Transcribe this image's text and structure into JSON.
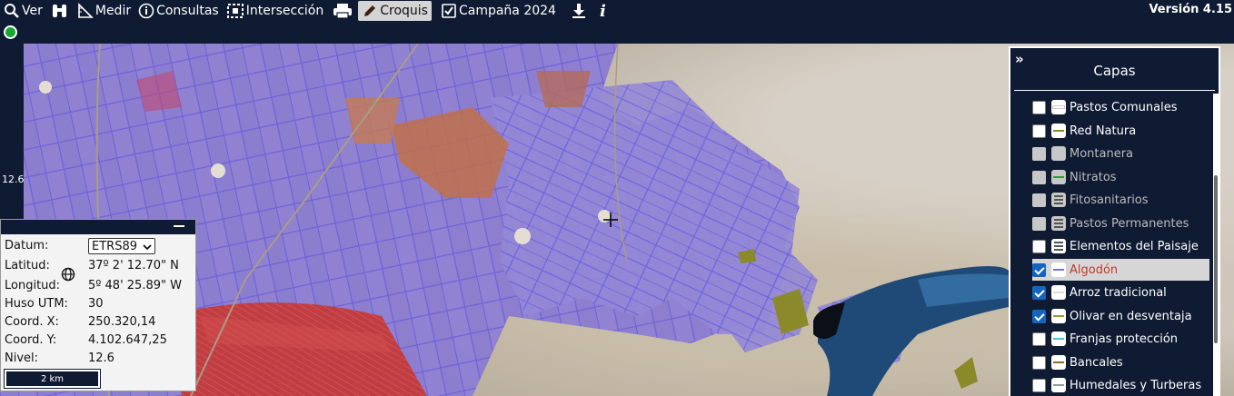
{
  "toolbar": {
    "items": [
      {
        "label": "Ver",
        "icon": "search-icon"
      },
      {
        "label": "",
        "icon": "binoculars-icon"
      },
      {
        "label": "Medir",
        "icon": "ruler-icon"
      },
      {
        "label": "Consultas",
        "icon": "info-circle-icon"
      },
      {
        "label": "Intersección",
        "icon": "dashed-select-icon"
      },
      {
        "label": "",
        "icon": "print-icon"
      },
      {
        "label": "Croquis",
        "icon": "pencil-icon",
        "active": true
      },
      {
        "label": "Campaña 2024",
        "icon": "checkbox-icon"
      },
      {
        "label": "",
        "icon": "download-icon"
      },
      {
        "label": "",
        "icon": "italic-info-icon"
      }
    ],
    "version": "Versión 4.15"
  },
  "status": {
    "color": "#18a834"
  },
  "map": {
    "zoom_level": "12.6"
  },
  "coords_panel": {
    "datum_label": "Datum:",
    "datum_value": "ETRS89",
    "lat_label": "Latitud:",
    "lat_value": "37º 2' 12.70\" N",
    "lon_label": "Longitud:",
    "lon_value": "5º 48' 25.89\" W",
    "huso_label": "Huso UTM:",
    "huso_value": "30",
    "x_label": "Coord. X:",
    "x_value": "250.320,14",
    "y_label": "Coord. Y:",
    "y_value": "4.102.647,25",
    "nivel_label": "Nivel:",
    "nivel_value": "12.6",
    "scale_label": "2 km"
  },
  "layers_panel": {
    "title": "Capas",
    "expand_glyph": "»",
    "items": [
      {
        "name": "Pastos Comunales",
        "checked": false,
        "enabled": true,
        "symbol": "white-bar",
        "color": "#ffffff"
      },
      {
        "name": "Red Natura",
        "checked": false,
        "enabled": true,
        "symbol": "bar",
        "color": "#8a8a2a"
      },
      {
        "name": "Montanera",
        "checked": false,
        "enabled": false,
        "symbol": "blank",
        "color": "#c7c7c7"
      },
      {
        "name": "Nitratos",
        "checked": false,
        "enabled": false,
        "symbol": "bar",
        "color": "#2e9b3a"
      },
      {
        "name": "Fitosanitarios",
        "checked": false,
        "enabled": false,
        "symbol": "lines",
        "color": "#555555"
      },
      {
        "name": "Pastos Permanentes",
        "checked": false,
        "enabled": false,
        "symbol": "lines",
        "color": "#555555"
      },
      {
        "name": "Elementos del Paisaje",
        "checked": false,
        "enabled": true,
        "symbol": "lines",
        "color": "#555555"
      },
      {
        "name": "Algodón",
        "checked": true,
        "enabled": true,
        "symbol": "bar",
        "color": "#7a6fd0",
        "selected": true
      },
      {
        "name": "Arroz tradicional",
        "checked": true,
        "enabled": true,
        "symbol": "bar",
        "color": "#dddddd"
      },
      {
        "name": "Olivar en desventaja",
        "checked": true,
        "enabled": true,
        "symbol": "bar",
        "color": "#9c9a2a"
      },
      {
        "name": "Franjas protección",
        "checked": false,
        "enabled": true,
        "symbol": "bar",
        "color": "#40c8e0"
      },
      {
        "name": "Bancales",
        "checked": false,
        "enabled": true,
        "symbol": "bar",
        "color": "#8a6a2a"
      },
      {
        "name": "Humedales y Turberas",
        "checked": false,
        "enabled": true,
        "symbol": "bar",
        "color": "#8aa0a0"
      }
    ]
  }
}
